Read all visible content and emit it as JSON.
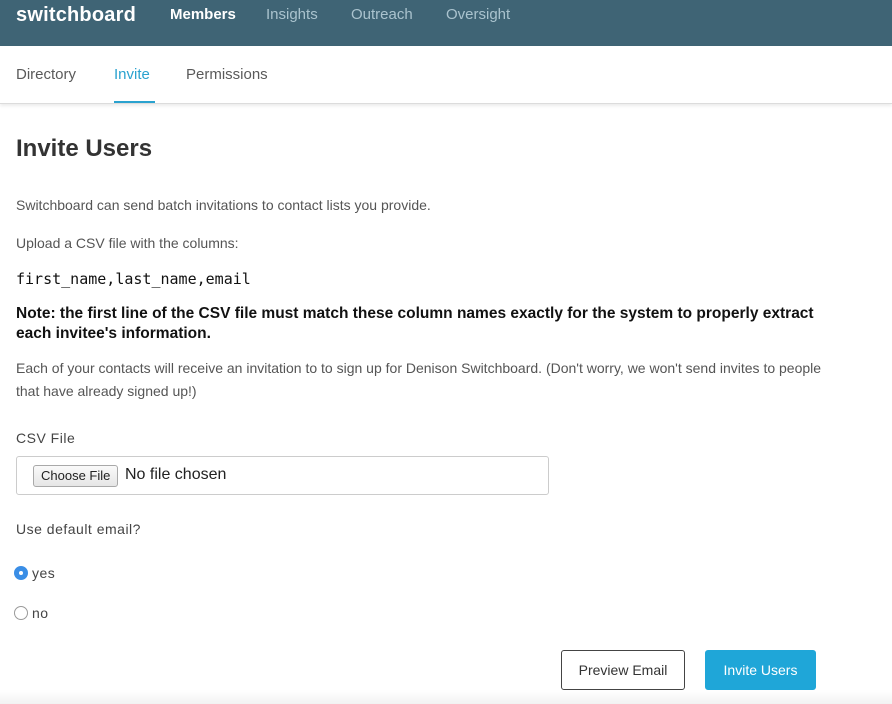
{
  "app": {
    "brand": "switchboard"
  },
  "topnav": {
    "items": [
      {
        "label": "Members",
        "active": true
      },
      {
        "label": "Insights",
        "active": false
      },
      {
        "label": "Outreach",
        "active": false
      },
      {
        "label": "Oversight",
        "active": false
      }
    ]
  },
  "subtabs": {
    "items": [
      {
        "label": "Directory",
        "active": false
      },
      {
        "label": "Invite",
        "active": true
      },
      {
        "label": "Permissions",
        "active": false
      }
    ]
  },
  "page": {
    "title": "Invite Users",
    "intro": "Switchboard can send batch invitations to contact lists you provide.",
    "upload_instructions": "Upload a CSV file with the columns:",
    "columns": "first_name,last_name,email",
    "note": "Note: the first line of the CSV file must match these column names exactly for the system to properly extract each invitee's information.",
    "info": "Each of your contacts will receive an invitation to to sign up for Denison Switchboard. (Don't worry, we won't send invites to people that have already signed up!)"
  },
  "form": {
    "csv_label": "CSV File",
    "choose_file_label": "Choose File",
    "file_status": "No file chosen",
    "default_email_label": "Use default email?",
    "radio_options": [
      {
        "label": "yes",
        "checked": true
      },
      {
        "label": "no",
        "checked": false
      }
    ],
    "preview_button": "Preview Email",
    "submit_button": "Invite Users"
  },
  "colors": {
    "navbar": "#3f6475",
    "accent": "#2aa2cf",
    "primary_button": "#1fa6d8",
    "radio_checked": "#3a8ee6"
  }
}
